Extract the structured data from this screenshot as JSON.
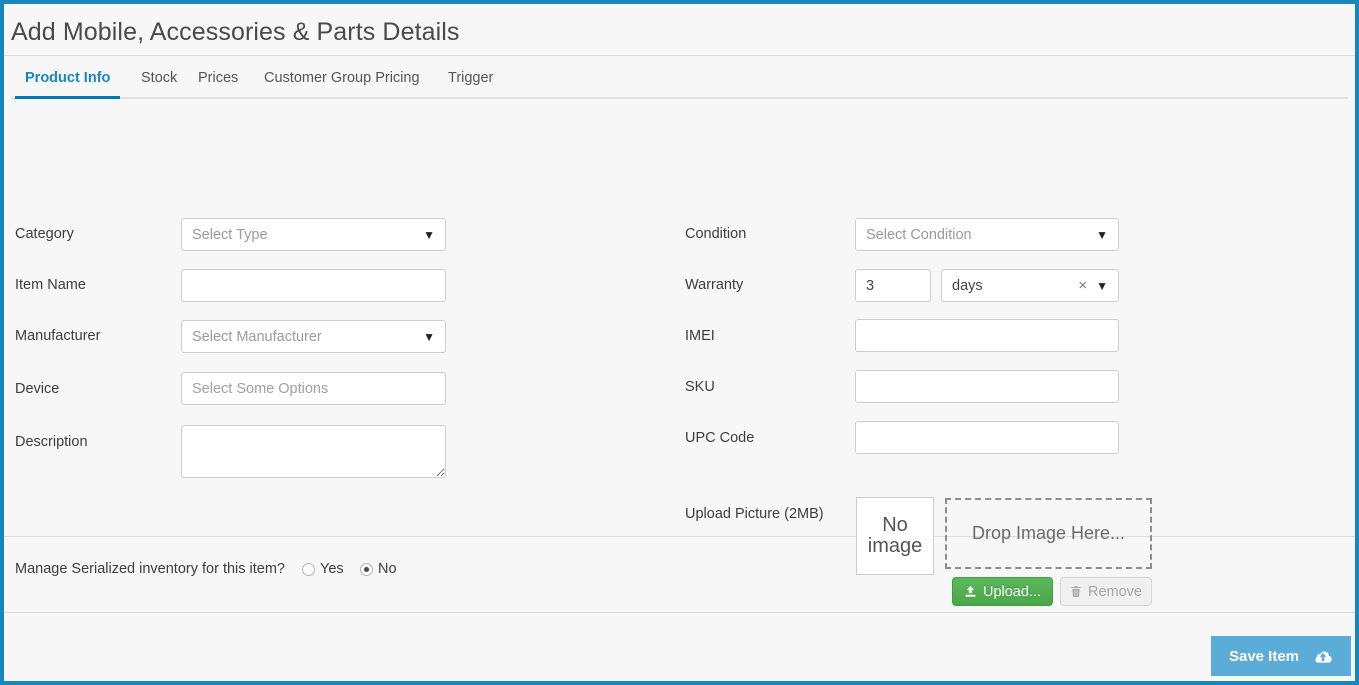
{
  "window": {
    "title": "Add Mobile, Accessories & Parts Details",
    "accent_border_color": "#1787bd",
    "background_color": "#f7f7f7"
  },
  "tabs": {
    "active": "Product Info",
    "items": [
      {
        "label": "Product Info"
      },
      {
        "label": "Stock"
      },
      {
        "label": "Prices"
      },
      {
        "label": "Customer Group Pricing"
      },
      {
        "label": "Trigger"
      }
    ],
    "active_color": "#1787c8",
    "underline_color": "#0077b5"
  },
  "form": {
    "left_column": {
      "category": {
        "label": "Category",
        "placeholder": "Select Type",
        "value": ""
      },
      "item_name": {
        "label": "Item Name",
        "placeholder": "",
        "value": ""
      },
      "manufacturer": {
        "label": "Manufacturer",
        "placeholder": "Select Manufacturer",
        "value": ""
      },
      "device": {
        "label": "Device",
        "placeholder": "Select Some Options",
        "value": ""
      },
      "description": {
        "label": "Description",
        "placeholder": "",
        "value": ""
      }
    },
    "right_column": {
      "condition": {
        "label": "Condition",
        "placeholder": "Select Condition",
        "value": ""
      },
      "warranty": {
        "label": "Warranty",
        "amount_value": "3",
        "unit_value": "days",
        "clear_icon": "close-x-icon",
        "caret_icon": "chevron-down-icon"
      },
      "imei": {
        "label": "IMEI",
        "placeholder": "",
        "value": ""
      },
      "sku": {
        "label": "SKU",
        "placeholder": "",
        "value": ""
      },
      "upc_code": {
        "label": "UPC Code",
        "placeholder": "",
        "value": ""
      },
      "upload_picture": {
        "label": "Upload Picture (2MB)",
        "no_image_text_line1": "No",
        "no_image_text_line2": "image",
        "dropzone_text": "Drop Image Here...",
        "upload_button": {
          "label": "Upload...",
          "icon": "upload-icon",
          "color": "#5cb85c"
        },
        "remove_button": {
          "label": "Remove",
          "icon": "trash-icon",
          "disabled": true
        }
      }
    }
  },
  "serialized": {
    "question": "Manage Serialized inventory for this item?",
    "options": [
      {
        "label": "Yes",
        "selected": false
      },
      {
        "label": "No",
        "selected": true
      }
    ]
  },
  "footer": {
    "save_button": {
      "label": "Save Item",
      "icon": "cloud-upload-icon",
      "color": "#5cacd8"
    }
  }
}
